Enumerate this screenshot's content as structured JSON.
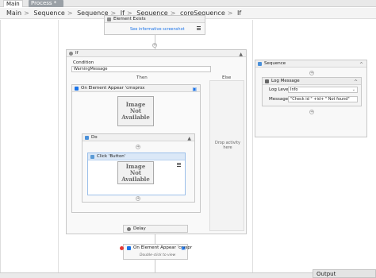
{
  "tabs": [
    {
      "label": "Main"
    },
    {
      "label": "Process *"
    }
  ],
  "breadcrumb": [
    "Main",
    "Sequence",
    "Sequence",
    "If",
    "Sequence",
    "coreSequence",
    "If"
  ],
  "element_exists": {
    "title": "Element Exists",
    "link": "See informative screenshot"
  },
  "if_block": {
    "title": "If",
    "condition_label": "Condition",
    "condition_value": "WarningMessage",
    "then_label": "Then",
    "else_label": "Else",
    "else_placeholder": "Drop activity here"
  },
  "on_element_appear": {
    "title": "On Element Appear 'cmsprox",
    "image_text": [
      "Image",
      "Not",
      "Available"
    ]
  },
  "do_block": {
    "title": "Do"
  },
  "click_button": {
    "title": "Click 'Button'",
    "image_text": [
      "Image",
      "Not",
      "Available"
    ]
  },
  "delay": {
    "title": "Delay"
  },
  "on_element_appear2": {
    "title": "On Element Appear 'cmspr",
    "hint": "Double-click to view"
  },
  "sequence": {
    "title": "Sequence"
  },
  "log_message": {
    "title": "Log Message",
    "log_level_label": "Log Level",
    "log_level_value": "Info",
    "message_label": "Message",
    "message_value": "\"Check id \" +id+ \" Not found\""
  },
  "output_panel": {
    "label": "Output"
  },
  "colors": {
    "accent_blue": "#1a73e8",
    "breakpoint_red": "#e53935",
    "click_header": "#dbe8f7"
  }
}
